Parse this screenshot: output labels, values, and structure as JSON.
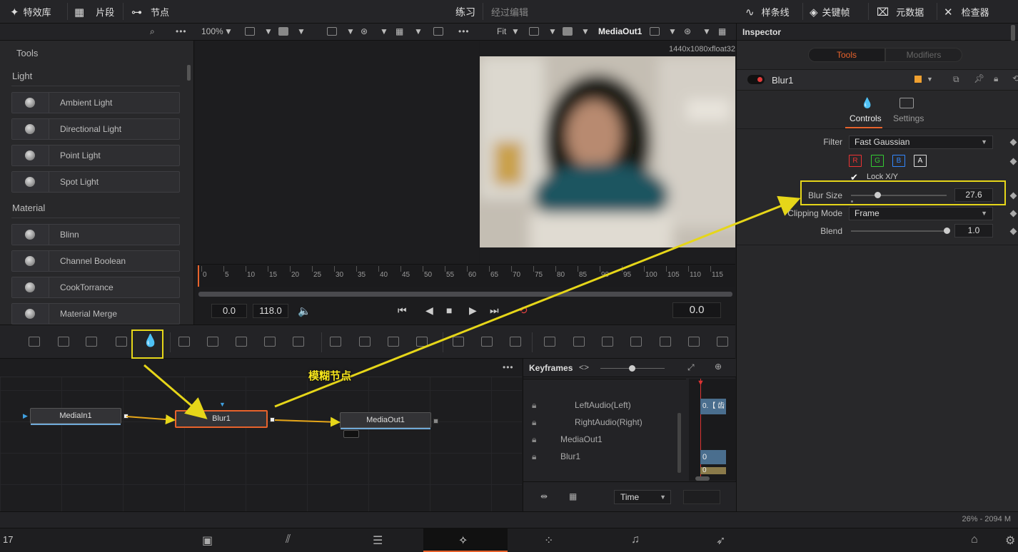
{
  "topbar": {
    "effects_library": "特效库",
    "clips": "片段",
    "nodes": "节点",
    "title": "练习",
    "edited": "经过编辑",
    "spline": "样条线",
    "keyframes": "关键帧",
    "metadata": "元数据",
    "inspector": "检查器"
  },
  "viewer": {
    "zoom_left": "100%",
    "zoom_right": "Fit",
    "output_name": "MediaOut1",
    "resolution": "1440x1080xfloat32"
  },
  "tools": {
    "header": "Tools",
    "categories": [
      {
        "name": "Light",
        "items": [
          "Ambient Light",
          "Directional Light",
          "Point Light",
          "Spot Light"
        ]
      },
      {
        "name": "Material",
        "items": [
          "Blinn",
          "Channel Boolean",
          "CookTorrance",
          "Material Merge"
        ]
      }
    ]
  },
  "timeline": {
    "ticks": [
      "0",
      "5",
      "10",
      "15",
      "20",
      "25",
      "30",
      "35",
      "40",
      "45",
      "50",
      "55",
      "60",
      "65",
      "70",
      "75",
      "80",
      "85",
      "90",
      "95",
      "100",
      "105",
      "110",
      "115"
    ],
    "start": "0.0",
    "end": "118.0",
    "current": "0.0"
  },
  "annotation": {
    "label": "模糊节点",
    "color": "#e6d619"
  },
  "nodes": {
    "input": "MediaIn1",
    "blur": "Blur1",
    "output": "MediaOut1"
  },
  "keyframes": {
    "title": "Keyframes",
    "rows": [
      "LeftAudio(Left)",
      "RightAudio(Right)",
      "MediaOut1",
      "Blur1"
    ],
    "track_values": [
      "0.【 齿",
      "0",
      "0"
    ],
    "time_label": "Time"
  },
  "inspector": {
    "title": "Inspector",
    "tab_tools": "Tools",
    "tab_modifiers": "Modifiers",
    "node_name": "Blur1",
    "controls_label": "Controls",
    "settings_label": "Settings",
    "filter_label": "Filter",
    "filter_value": "Fast Gaussian",
    "channels": [
      "R",
      "G",
      "B",
      "A"
    ],
    "lock_label": "Lock X/Y",
    "blur_size_label": "Blur Size",
    "blur_size_value": "27.6",
    "blur_size_fraction": 0.28,
    "clipping_label": "Clipping Mode",
    "clipping_value": "Frame",
    "blend_label": "Blend",
    "blend_value": "1.0",
    "blend_fraction": 1.0,
    "accent": "#e8632c"
  },
  "status": {
    "left": "17",
    "right": "26% - 2094 M"
  }
}
